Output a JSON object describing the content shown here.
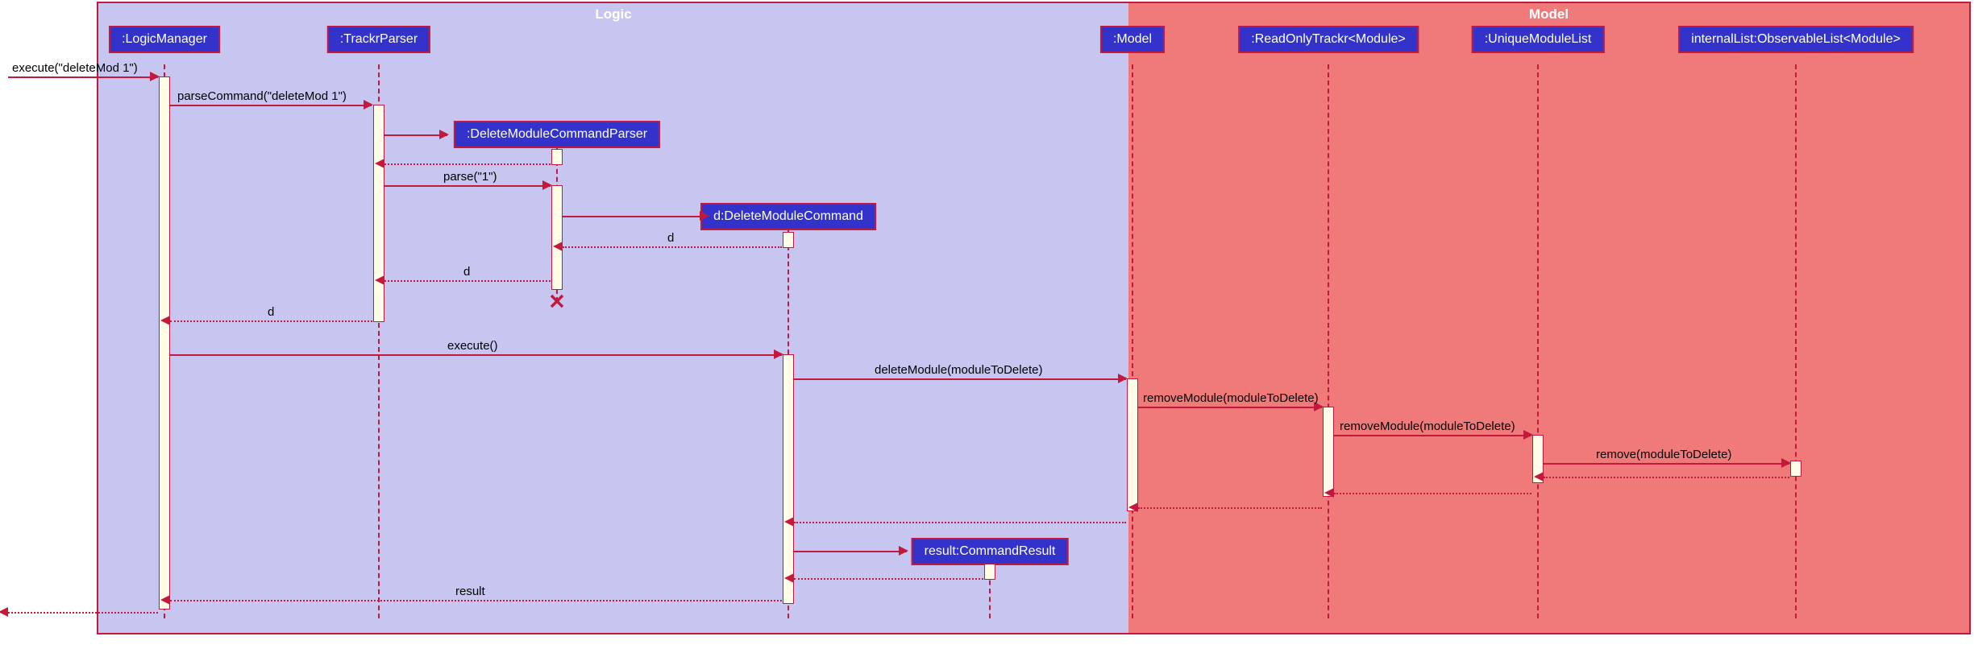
{
  "boxes": {
    "logic": "Logic",
    "model": "Model"
  },
  "participants": {
    "logicManager": ":LogicManager",
    "trackrParser": ":TrackrParser",
    "deleteModuleCommandParser": ":DeleteModuleCommandParser",
    "deleteModuleCommand": "d:DeleteModuleCommand",
    "commandResult": "result:CommandResult",
    "model": ":Model",
    "readOnlyTrackr": ":ReadOnlyTrackr<Module>",
    "uniqueModuleList": ":UniqueModuleList",
    "observableList": "internalList:ObservableList<Module>"
  },
  "messages": {
    "m1": "execute(\"deleteMod 1\")",
    "m2": "parseCommand(\"deleteMod 1\")",
    "m3": "parse(\"1\")",
    "m4": "d",
    "m5": "d",
    "m6": "d",
    "m7": "execute()",
    "m8": "deleteModule(moduleToDelete)",
    "m9": "removeModule(moduleToDelete)",
    "m10": "removeModule(moduleToDelete)",
    "m11": "remove(moduleToDelete)",
    "m12": "result"
  }
}
